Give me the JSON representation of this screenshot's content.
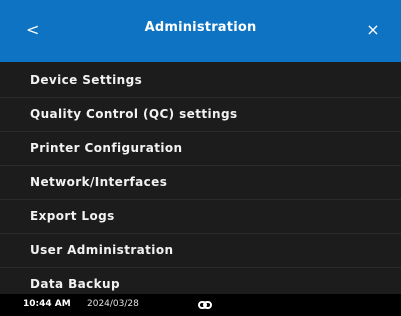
{
  "header": {
    "title": "Administration",
    "back_glyph": "<",
    "close_glyph": "×",
    "background_color": "#0d73c2"
  },
  "menu": {
    "items": [
      {
        "label": "Device Settings"
      },
      {
        "label": "Quality Control (QC) settings"
      },
      {
        "label": "Printer Configuration"
      },
      {
        "label": "Network/Interfaces"
      },
      {
        "label": "Export Logs"
      },
      {
        "label": "User Administration"
      },
      {
        "label": "Data Backup"
      }
    ]
  },
  "status_bar": {
    "time": "10:44 AM",
    "date": "2024/03/28",
    "connection_icon": "link-icon"
  }
}
